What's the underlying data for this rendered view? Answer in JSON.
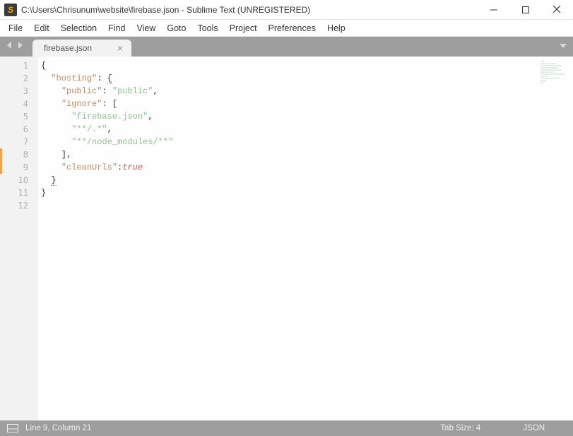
{
  "window": {
    "title": "C:\\Users\\Chrisunum\\website\\firebase.json - Sublime Text (UNREGISTERED)"
  },
  "menu": {
    "items": [
      "File",
      "Edit",
      "Selection",
      "Find",
      "View",
      "Goto",
      "Tools",
      "Project",
      "Preferences",
      "Help"
    ]
  },
  "tabs": {
    "active": {
      "label": "firebase.json",
      "close": "×"
    }
  },
  "code": {
    "total_lines": 12,
    "highlighted_line": 9,
    "modified_lines": [
      8,
      9
    ],
    "tokens": [
      [
        {
          "t": "p",
          "v": "{"
        }
      ],
      [
        {
          "t": "p",
          "v": "  "
        },
        {
          "t": "k",
          "v": "\"hosting\""
        },
        {
          "t": "p",
          "v": ": "
        },
        {
          "t": "p",
          "v": "{",
          "bh": true
        }
      ],
      [
        {
          "t": "p",
          "v": "    "
        },
        {
          "t": "k",
          "v": "\"public\""
        },
        {
          "t": "p",
          "v": ": "
        },
        {
          "t": "s",
          "v": "\"public\""
        },
        {
          "t": "p",
          "v": ","
        }
      ],
      [
        {
          "t": "p",
          "v": "    "
        },
        {
          "t": "k",
          "v": "\"ignore\""
        },
        {
          "t": "p",
          "v": ": ["
        }
      ],
      [
        {
          "t": "p",
          "v": "      "
        },
        {
          "t": "s",
          "v": "\"firebase.json\""
        },
        {
          "t": "p",
          "v": ","
        }
      ],
      [
        {
          "t": "p",
          "v": "      "
        },
        {
          "t": "s",
          "v": "\"**/.*\""
        },
        {
          "t": "p",
          "v": ","
        }
      ],
      [
        {
          "t": "p",
          "v": "      "
        },
        {
          "t": "s",
          "v": "\"**/node_modules/**\""
        }
      ],
      [
        {
          "t": "p",
          "v": "    ],"
        }
      ],
      [
        {
          "t": "p",
          "v": "    "
        },
        {
          "t": "k",
          "v": "\"cleanUrls\""
        },
        {
          "t": "p",
          "v": ":"
        },
        {
          "t": "c",
          "v": "true"
        }
      ],
      [
        {
          "t": "p",
          "v": "  "
        },
        {
          "t": "p",
          "v": "}",
          "bh": true
        }
      ],
      [
        {
          "t": "p",
          "v": "}"
        }
      ],
      []
    ]
  },
  "status": {
    "cursor": "Line 9, Column 21",
    "tab_size": "Tab Size: 4",
    "syntax": "JSON"
  }
}
